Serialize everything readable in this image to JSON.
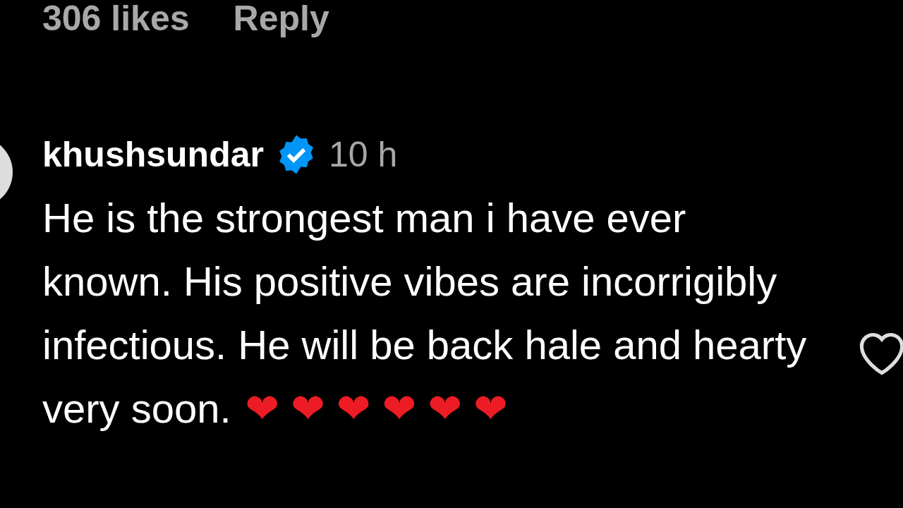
{
  "previous_comment": {
    "likes": "306 likes",
    "reply": "Reply"
  },
  "comment": {
    "username": "khushsundar",
    "verified": true,
    "time": "10 h",
    "text": "He is the strongest man i have ever known. His positive vibes are incorrigibly infectious. He will be back hale and hearty very soon.",
    "emojis": "❤ ❤ ❤ ❤ ❤ ❤",
    "liked": false
  }
}
